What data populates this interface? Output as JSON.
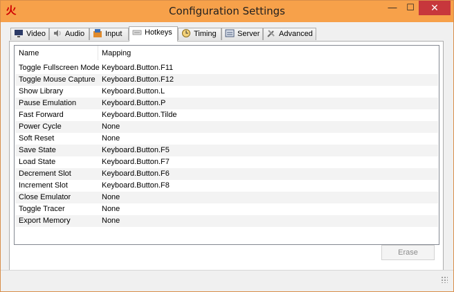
{
  "window": {
    "title": "Configuration Settings",
    "app_icon": "火",
    "minimize_glyph": "—",
    "maximize_glyph": "☐",
    "close_glyph": "✕"
  },
  "tabs": [
    {
      "label": "Video",
      "icon": "monitor-icon"
    },
    {
      "label": "Audio",
      "icon": "speaker-icon"
    },
    {
      "label": "Input",
      "icon": "input-icon"
    },
    {
      "label": "Hotkeys",
      "icon": "keyboard-icon",
      "active": true
    },
    {
      "label": "Timing",
      "icon": "clock-icon"
    },
    {
      "label": "Server",
      "icon": "server-icon"
    },
    {
      "label": "Advanced",
      "icon": "tools-icon"
    }
  ],
  "list": {
    "headers": {
      "name": "Name",
      "mapping": "Mapping"
    },
    "rows": [
      {
        "name": "Toggle Fullscreen Mode",
        "mapping": "Keyboard.Button.F11"
      },
      {
        "name": "Toggle Mouse Capture",
        "mapping": "Keyboard.Button.F12"
      },
      {
        "name": "Show Library",
        "mapping": "Keyboard.Button.L"
      },
      {
        "name": "Pause Emulation",
        "mapping": "Keyboard.Button.P"
      },
      {
        "name": "Fast Forward",
        "mapping": "Keyboard.Button.Tilde"
      },
      {
        "name": "Power Cycle",
        "mapping": "None"
      },
      {
        "name": "Soft Reset",
        "mapping": "None"
      },
      {
        "name": "Save State",
        "mapping": "Keyboard.Button.F5"
      },
      {
        "name": "Load State",
        "mapping": "Keyboard.Button.F7"
      },
      {
        "name": "Decrement Slot",
        "mapping": "Keyboard.Button.F6"
      },
      {
        "name": "Increment Slot",
        "mapping": "Keyboard.Button.F8"
      },
      {
        "name": "Close Emulator",
        "mapping": "None"
      },
      {
        "name": "Toggle Tracer",
        "mapping": "None"
      },
      {
        "name": "Export Memory",
        "mapping": "None"
      }
    ]
  },
  "buttons": {
    "erase": "Erase"
  },
  "colors": {
    "titlebar": "#f7a14a",
    "close": "#c7373c",
    "app_icon": "#d00000"
  }
}
